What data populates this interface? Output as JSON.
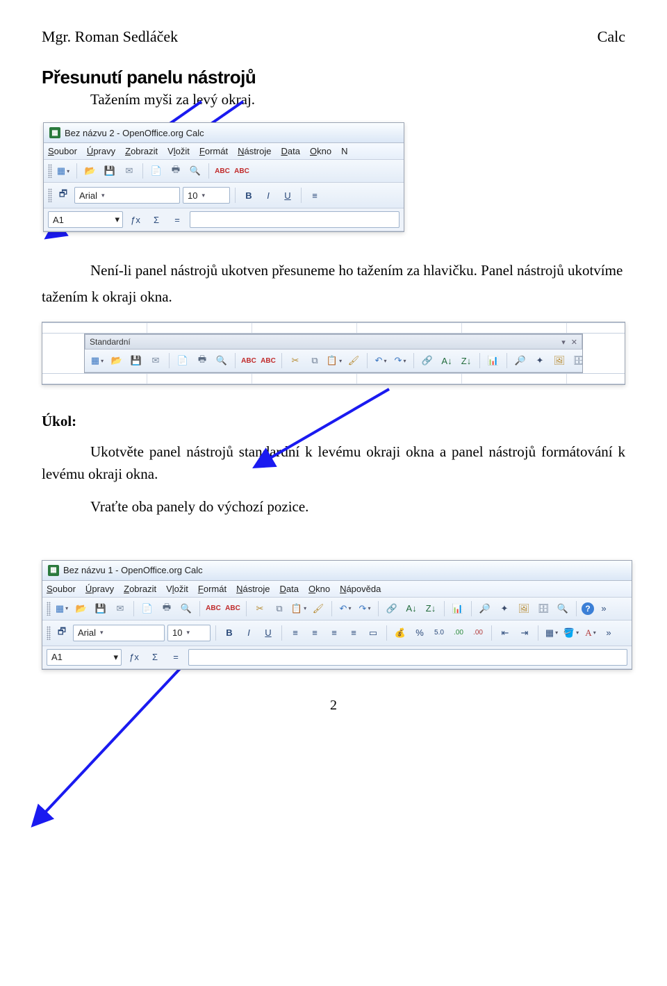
{
  "header": {
    "left": "Mgr. Roman Sedláček",
    "right": "Calc"
  },
  "section_title": "Přesunutí panelu nástrojů",
  "section_sub": "Tažením myši za levý okraj.",
  "para1a": "Není-li panel nástrojů ukotven přesuneme ho tažením za hlavičku. Panel nástrojů ukotvíme",
  "para1b": "tažením k okraji okna.",
  "task_label": "Úkol:",
  "task_text": "Ukotvěte panel nástrojů standardní k levému okraji okna a panel nástrojů formátování k levému okraji okna.",
  "task_text2": "Vraťte oba panely do výchozí pozice.",
  "page_number": "2",
  "shot1": {
    "title": "Bez názvu 2 - OpenOffice.org Calc",
    "menu": [
      "Soubor",
      "Úpravy",
      "Zobrazit",
      "Vložit",
      "Formát",
      "Nástroje",
      "Data",
      "Okno",
      "N"
    ],
    "menu_ul": [
      "S",
      "Ú",
      "Z",
      "V",
      "F",
      "N",
      "D",
      "O",
      "N"
    ],
    "font_name": "Arial",
    "font_size": "10",
    "cell_ref": "A1",
    "fx": "ƒx",
    "sigma": "Σ",
    "eq": "=",
    "bold": "B",
    "ital": "I",
    "ul": "U",
    "align": "≡"
  },
  "shot2": {
    "floating_title": "Standardní",
    "abc": "ABC"
  },
  "shot3": {
    "title": "Bez názvu 1 - OpenOffice.org Calc",
    "menu": [
      "Soubor",
      "Úpravy",
      "Zobrazit",
      "Vložit",
      "Formát",
      "Nástroje",
      "Data",
      "Okno",
      "Nápověda"
    ],
    "menu_ul": [
      "S",
      "Ú",
      "Z",
      "V",
      "F",
      "N",
      "D",
      "O",
      "N"
    ],
    "font_name": "Arial",
    "font_size": "10",
    "cell_ref": "A1",
    "fx": "ƒx",
    "sigma": "Σ",
    "eq": "=",
    "bold": "B",
    "ital": "I",
    "ul": "U",
    "percent": "%",
    "abc": "ABC"
  }
}
